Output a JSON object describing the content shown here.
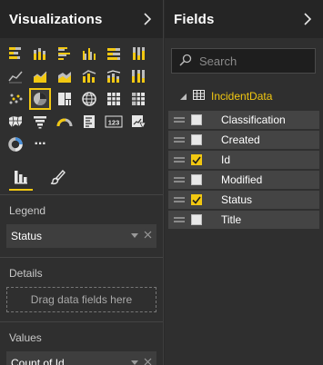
{
  "visualizations": {
    "title": "Visualizations",
    "collapse_icon": "chevron-right-icon",
    "gallery": [
      {
        "name": "stacked-bar-chart-icon"
      },
      {
        "name": "stacked-column-chart-icon"
      },
      {
        "name": "clustered-bar-chart-icon"
      },
      {
        "name": "clustered-column-chart-icon"
      },
      {
        "name": "100-stacked-bar-chart-icon"
      },
      {
        "name": "100-stacked-column-chart-icon"
      },
      {
        "name": "line-chart-icon"
      },
      {
        "name": "area-chart-icon"
      },
      {
        "name": "stacked-area-chart-icon"
      },
      {
        "name": "line-and-column-chart-icon"
      },
      {
        "name": "line-and-stacked-column-chart-icon"
      },
      {
        "name": "ribbon-chart-icon"
      },
      {
        "name": "scatter-chart-icon"
      },
      {
        "name": "pie-chart-icon",
        "selected": true
      },
      {
        "name": "treemap-icon"
      },
      {
        "name": "map-icon"
      },
      {
        "name": "table-icon"
      },
      {
        "name": "matrix-icon"
      },
      {
        "name": "filled-map-icon"
      },
      {
        "name": "funnel-chart-icon"
      },
      {
        "name": "gauge-icon"
      },
      {
        "name": "multi-row-card-icon"
      },
      {
        "name": "card-icon"
      },
      {
        "name": "kpi-icon"
      },
      {
        "name": "donut-chart-icon"
      },
      {
        "name": "more-visuals-icon"
      }
    ],
    "card_text": "123",
    "more_text": "···",
    "tools": [
      {
        "name": "fields-tab-icon",
        "active": true
      },
      {
        "name": "format-paintbrush-icon",
        "active": false
      }
    ],
    "wells": {
      "legend": {
        "label": "Legend",
        "field": "Status"
      },
      "details": {
        "label": "Details",
        "placeholder": "Drag data fields here"
      },
      "values": {
        "label": "Values",
        "field": "Count of Id"
      }
    }
  },
  "fields": {
    "title": "Fields",
    "collapse_icon": "chevron-right-icon",
    "search_placeholder": "Search",
    "table": {
      "name": "IncidentData",
      "expanded": true
    },
    "items": [
      {
        "label": "Classification",
        "checked": false
      },
      {
        "label": "Created",
        "checked": false
      },
      {
        "label": "Id",
        "checked": true
      },
      {
        "label": "Modified",
        "checked": false
      },
      {
        "label": "Status",
        "checked": true
      },
      {
        "label": "Title",
        "checked": false
      }
    ]
  },
  "colors": {
    "accent": "#f2c811",
    "pane_bg": "#2f2f2f",
    "header_bg": "#252525",
    "field_bg": "#444444"
  }
}
